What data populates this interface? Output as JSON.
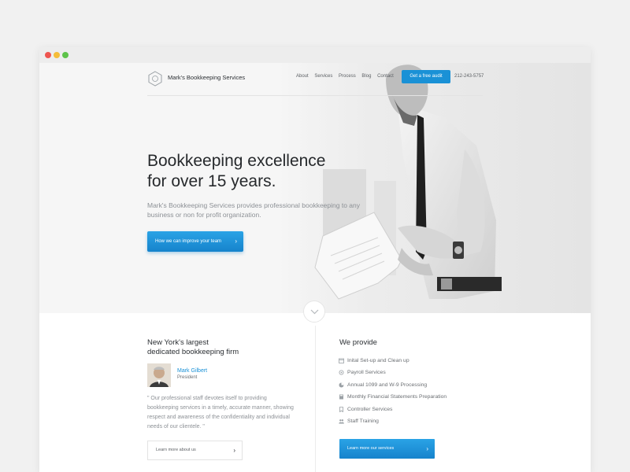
{
  "nav": {
    "brand": "Mark's Bookkeeping Services",
    "links": [
      "About",
      "Services",
      "Process",
      "Blog",
      "Contact"
    ],
    "cta": "Get a free audit",
    "phone": "212-243-5757"
  },
  "hero": {
    "title_line1": "Bookkeeping excellence",
    "title_line2": "for over 15 years.",
    "subtitle": "Mark's Bookkeeping Services provides professional bookkeeping to any business or non for profit organization.",
    "button": "How we can improve your team"
  },
  "about": {
    "title_line1": "New York's largest",
    "title_line2": "dedicated bookkeeping firm",
    "person_name": "Mark Gilbert",
    "person_role": "President",
    "quote": "\" Our professional staff devotes itself to providing bookkeeping services in a timely, accurate manner, showing respect and awareness of the confidentiality and individual needs of our clientele. \"",
    "button": "Learn more about us"
  },
  "services": {
    "title": "We provide",
    "items": [
      {
        "label": "Inital Set-up and Clean up",
        "icon": "calendar-icon"
      },
      {
        "label": "Payroll Services",
        "icon": "settings-icon"
      },
      {
        "label": "Annual 1099 and W-9 Processing",
        "icon": "pie-chart-icon"
      },
      {
        "label": "Monthly Financial Statements Preparation",
        "icon": "calculator-icon"
      },
      {
        "label": "Controller Services",
        "icon": "bookmark-icon"
      },
      {
        "label": "Staff Training",
        "icon": "people-icon"
      }
    ],
    "button": "Learn more our services"
  },
  "colors": {
    "accent": "#1a91d6",
    "text": "#2b2f33",
    "muted": "#8d9196"
  }
}
